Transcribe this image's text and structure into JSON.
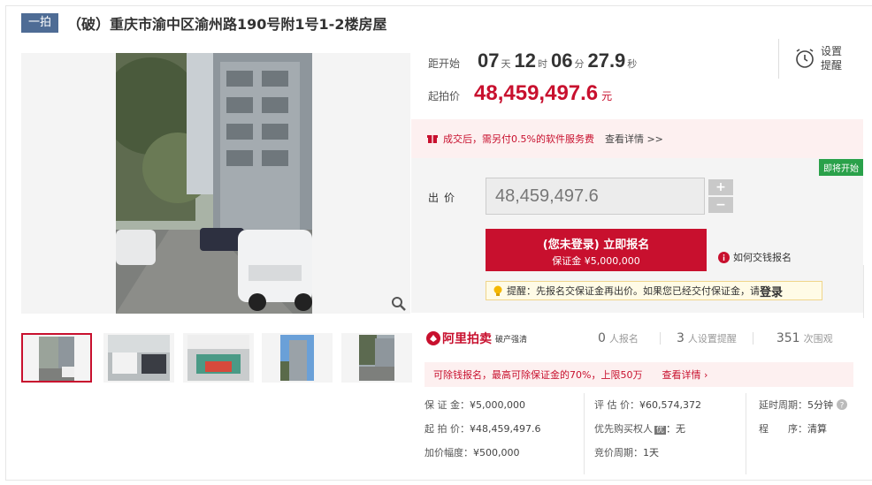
{
  "header": {
    "tag": "一拍",
    "title": "（破）重庆市渝中区渝州路190号附1号1-2楼房屋"
  },
  "countdown": {
    "label": "距开始",
    "days": "07",
    "days_unit": "天",
    "hours": "12",
    "hours_unit": "时",
    "minutes": "06",
    "minutes_unit": "分",
    "seconds": "27.9",
    "seconds_unit": "秒"
  },
  "start_price": {
    "label": "起拍价",
    "value": "48,459,497.6",
    "unit": "元"
  },
  "reminder": {
    "line1": "设置",
    "line2": "提醒"
  },
  "notice": {
    "text": "成交后，需另付0.5%的软件服务费",
    "link": "查看详情 >>"
  },
  "bid": {
    "badge": "即将开始",
    "label": "出价",
    "value": "48,459,497.6",
    "plus": "+",
    "minus": "−",
    "register_line1": "(您未登录) 立即报名",
    "register_line2": "保证金 ¥5,000,000",
    "howto": "如何交钱报名",
    "tip_text": "提醒：先报名交保证金再出价。如果您已经交付保证金，请",
    "tip_login": "登录"
  },
  "stats": {
    "logo": "阿里拍卖",
    "logo_sub": "破产强清",
    "registered_num": "0",
    "registered_unit": "人报名",
    "reminders_num": "3",
    "reminders_unit": "人设置提醒",
    "views_num": "351",
    "views_unit": "次围观"
  },
  "pool": {
    "text": "可除钱报名，最高可除保证金的70%，上限50万",
    "link": "查看详情"
  },
  "details": {
    "deposit_label": "保 证 金：",
    "deposit_value": "¥5,000,000",
    "start_label": "起 拍 价：",
    "start_value": "¥48,459,497.6",
    "increment_label": "加价幅度：",
    "increment_value": "¥500,000",
    "appraisal_label": "评 估 价：",
    "appraisal_value": "¥60,574,372",
    "priority_label": "优先购买权人",
    "priority_badge": "优",
    "priority_value": "：无",
    "cycle_label": "竞价周期：",
    "cycle_value": "1天",
    "delay_label": "延时周期：",
    "delay_value": "5分钟",
    "procedure_label": "程　　序：",
    "procedure_value": "清算"
  },
  "colors": {
    "accent": "#c8102e",
    "tag_bg": "#4e6c95",
    "badge_green": "#2aa14a"
  }
}
